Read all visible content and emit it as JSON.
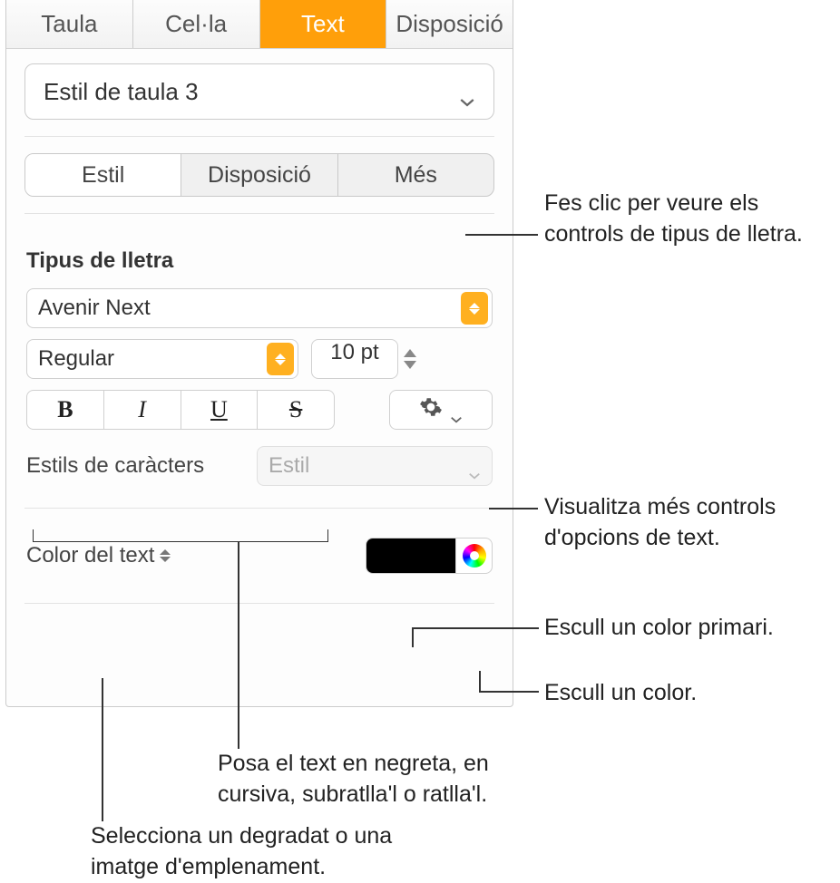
{
  "top_tabs": {
    "table": "Taula",
    "cell": "Cel·la",
    "text": "Text",
    "layout": "Disposició"
  },
  "style_select": "Estil de taula 3",
  "subtabs": {
    "style": "Estil",
    "layout": "Disposició",
    "more": "Més"
  },
  "font_section_title": "Tipus de lletra",
  "font_family": "Avenir Next",
  "font_weight": "Regular",
  "font_size": "10 pt",
  "format_icons": {
    "bold": "B",
    "italic": "I",
    "underline": "U",
    "strike": "S"
  },
  "char_styles_label": "Estils de caràcters",
  "char_style_placeholder": "Estil",
  "text_color_label": "Color del text",
  "callouts": {
    "font_controls": "Fes clic per veure els controls de tipus de lletra.",
    "more_options": "Visualitza més controls d'opcions de text.",
    "primary_color": "Escull un color primari.",
    "pick_color": "Escull un color.",
    "bius": "Posa el text en negreta, en cursiva, subratlla'l o ratlla'l.",
    "gradient_fill": "Selecciona un degradat o una imatge d'emplenament."
  }
}
